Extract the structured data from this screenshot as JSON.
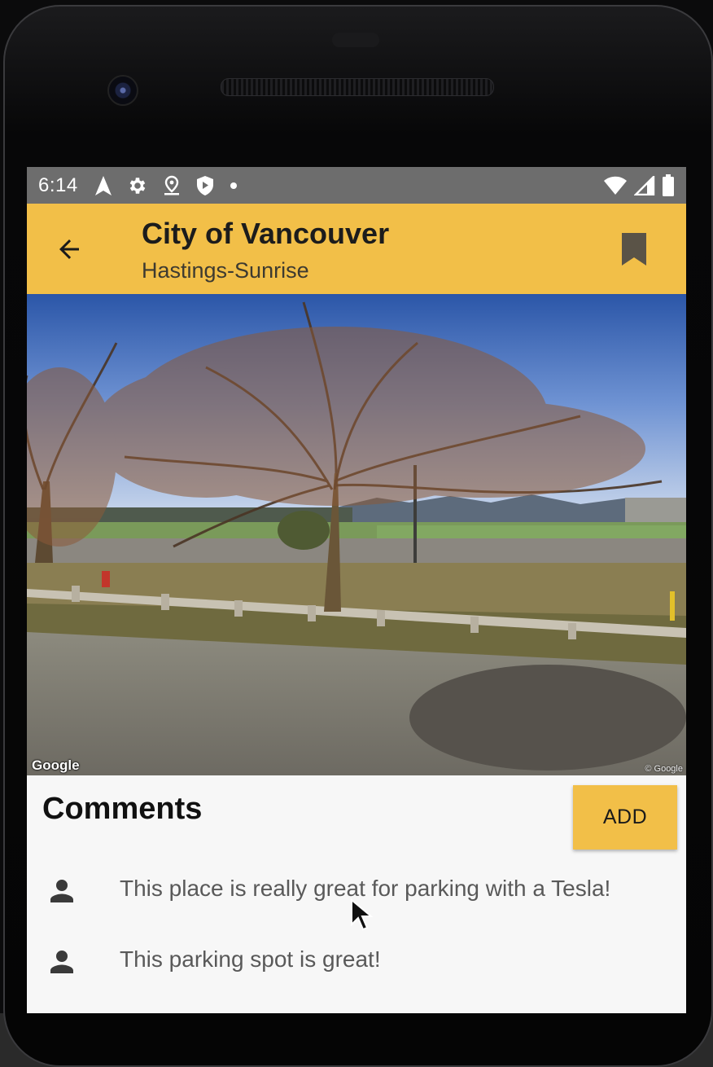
{
  "status_bar": {
    "time": "6:14",
    "left_icons": [
      "navigation-icon",
      "gear-icon",
      "location-pin-icon",
      "shield-icon",
      "dot-icon"
    ],
    "right_icons": [
      "wifi-icon",
      "signal-icon",
      "battery-icon"
    ]
  },
  "app_bar": {
    "title": "City of Vancouver",
    "subtitle": "Hastings-Sunrise",
    "accent_color": "#F2BF48"
  },
  "street_view": {
    "attribution_left": "Google",
    "attribution_right": "© Google"
  },
  "comments": {
    "heading": "Comments",
    "add_label": "ADD",
    "items": [
      {
        "text": "This place is really great for parking with a Tesla!"
      },
      {
        "text": "This parking spot is great!"
      }
    ]
  }
}
